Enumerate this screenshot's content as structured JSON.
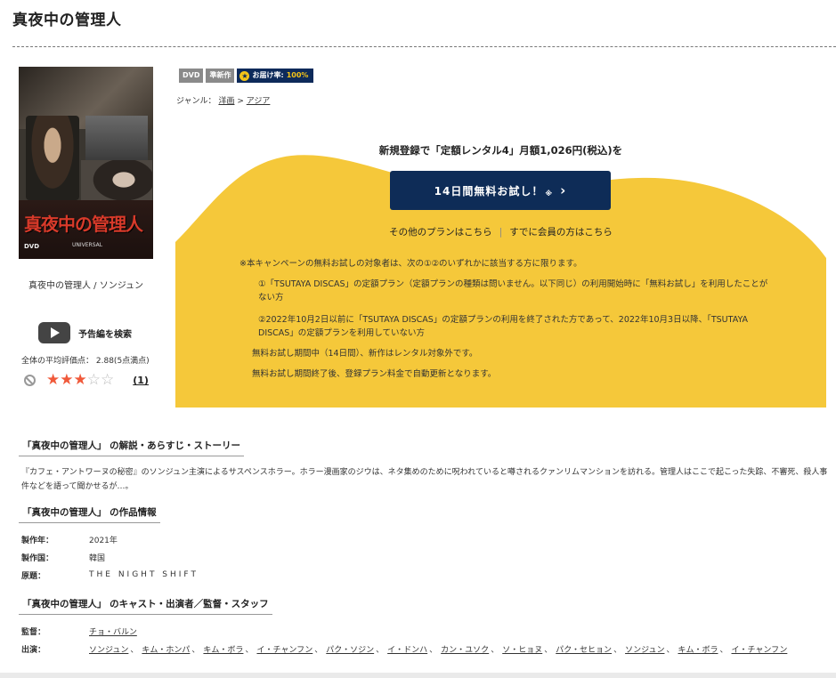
{
  "title": "真夜中の管理人",
  "poster": {
    "title_text": "真夜中の管理人",
    "dvd_mark": "DVD",
    "label_mark": "UNIVERSAL",
    "caption": "真夜中の管理人 / ソンジュン"
  },
  "badges": {
    "dvd": "DVD",
    "new": "準新作",
    "delivery_label": "お届け率:",
    "delivery_value": "100%"
  },
  "genre": {
    "label": "ジャンル：",
    "items": [
      "洋画",
      "アジア"
    ],
    "separator": ">"
  },
  "trailer": {
    "label": "予告編を検索"
  },
  "rating": {
    "average_text": "全体の平均評価点：",
    "average_value": "2.88(5点満点)",
    "stars_filled": 3,
    "stars_total": 5,
    "review_count": "(1)"
  },
  "campaign": {
    "headline": "新規登録で「定額レンタル4」月額1,026円(税込)を",
    "button_label": "14日間無料お試し！",
    "button_mark": "※",
    "other_plans": "その他のプランはこちら",
    "separator": "|",
    "member_link": "すでに会員の方はこちら",
    "notes": [
      "※本キャンペーンの無料お試しの対象者は、次の①②のいずれかに該当する方に限ります。",
      "①「TSUTAYA DISCAS」の定額プラン（定額プランの種類は問いません。以下同じ）の利用開始時に「無料お試し」を利用したことがない方",
      "②2022年10月2日以前に「TSUTAYA DISCAS」の定額プランの利用を終了された方であって、2022年10月3日以降、「TSUTAYA DISCAS」の定額プランを利用していない方",
      "無料お試し期間中（14日間）、新作はレンタル対象外です。",
      "無料お試し期間終了後、登録プラン料金で自動更新となります。"
    ],
    "colors": {
      "yellow": "#f5c83a",
      "navy": "#0e2c57"
    }
  },
  "synopsis": {
    "heading": "「真夜中の管理人」 の解説・あらすじ・ストーリー",
    "text": "『カフェ・アントワーヌの秘密』のソンジュン主演によるサスペンスホラー。ホラー漫画家のジウは、ネタ集めのために呪われていると噂されるクァンリムマンションを訪れる。管理人はここで起こった失踪、不審死、殺人事件などを語って聞かせるが…。"
  },
  "info": {
    "heading": "「真夜中の管理人」 の作品情報",
    "rows": [
      {
        "key": "製作年：",
        "value": "2021年"
      },
      {
        "key": "製作国：",
        "value": "韓国"
      },
      {
        "key": "原題：",
        "value": "THE NIGHT SHIFT"
      }
    ]
  },
  "cast": {
    "heading": "「真夜中の管理人」 のキャスト・出演者／監督・スタッフ",
    "director_label": "監督：",
    "director": "チョ・バルン",
    "cast_label": "出演：",
    "members": [
      "ソンジュン",
      "キム・ホンパ",
      "キム・ボラ",
      "イ・チャンフン",
      "パク・ソジン",
      "イ・ドンハ",
      "カン・ユソク",
      "ソ・ヒョヌ",
      "パク・セヒョン",
      "ソンジュン",
      "キム・ボラ",
      "イ・チャンフン"
    ],
    "comma": "、"
  }
}
